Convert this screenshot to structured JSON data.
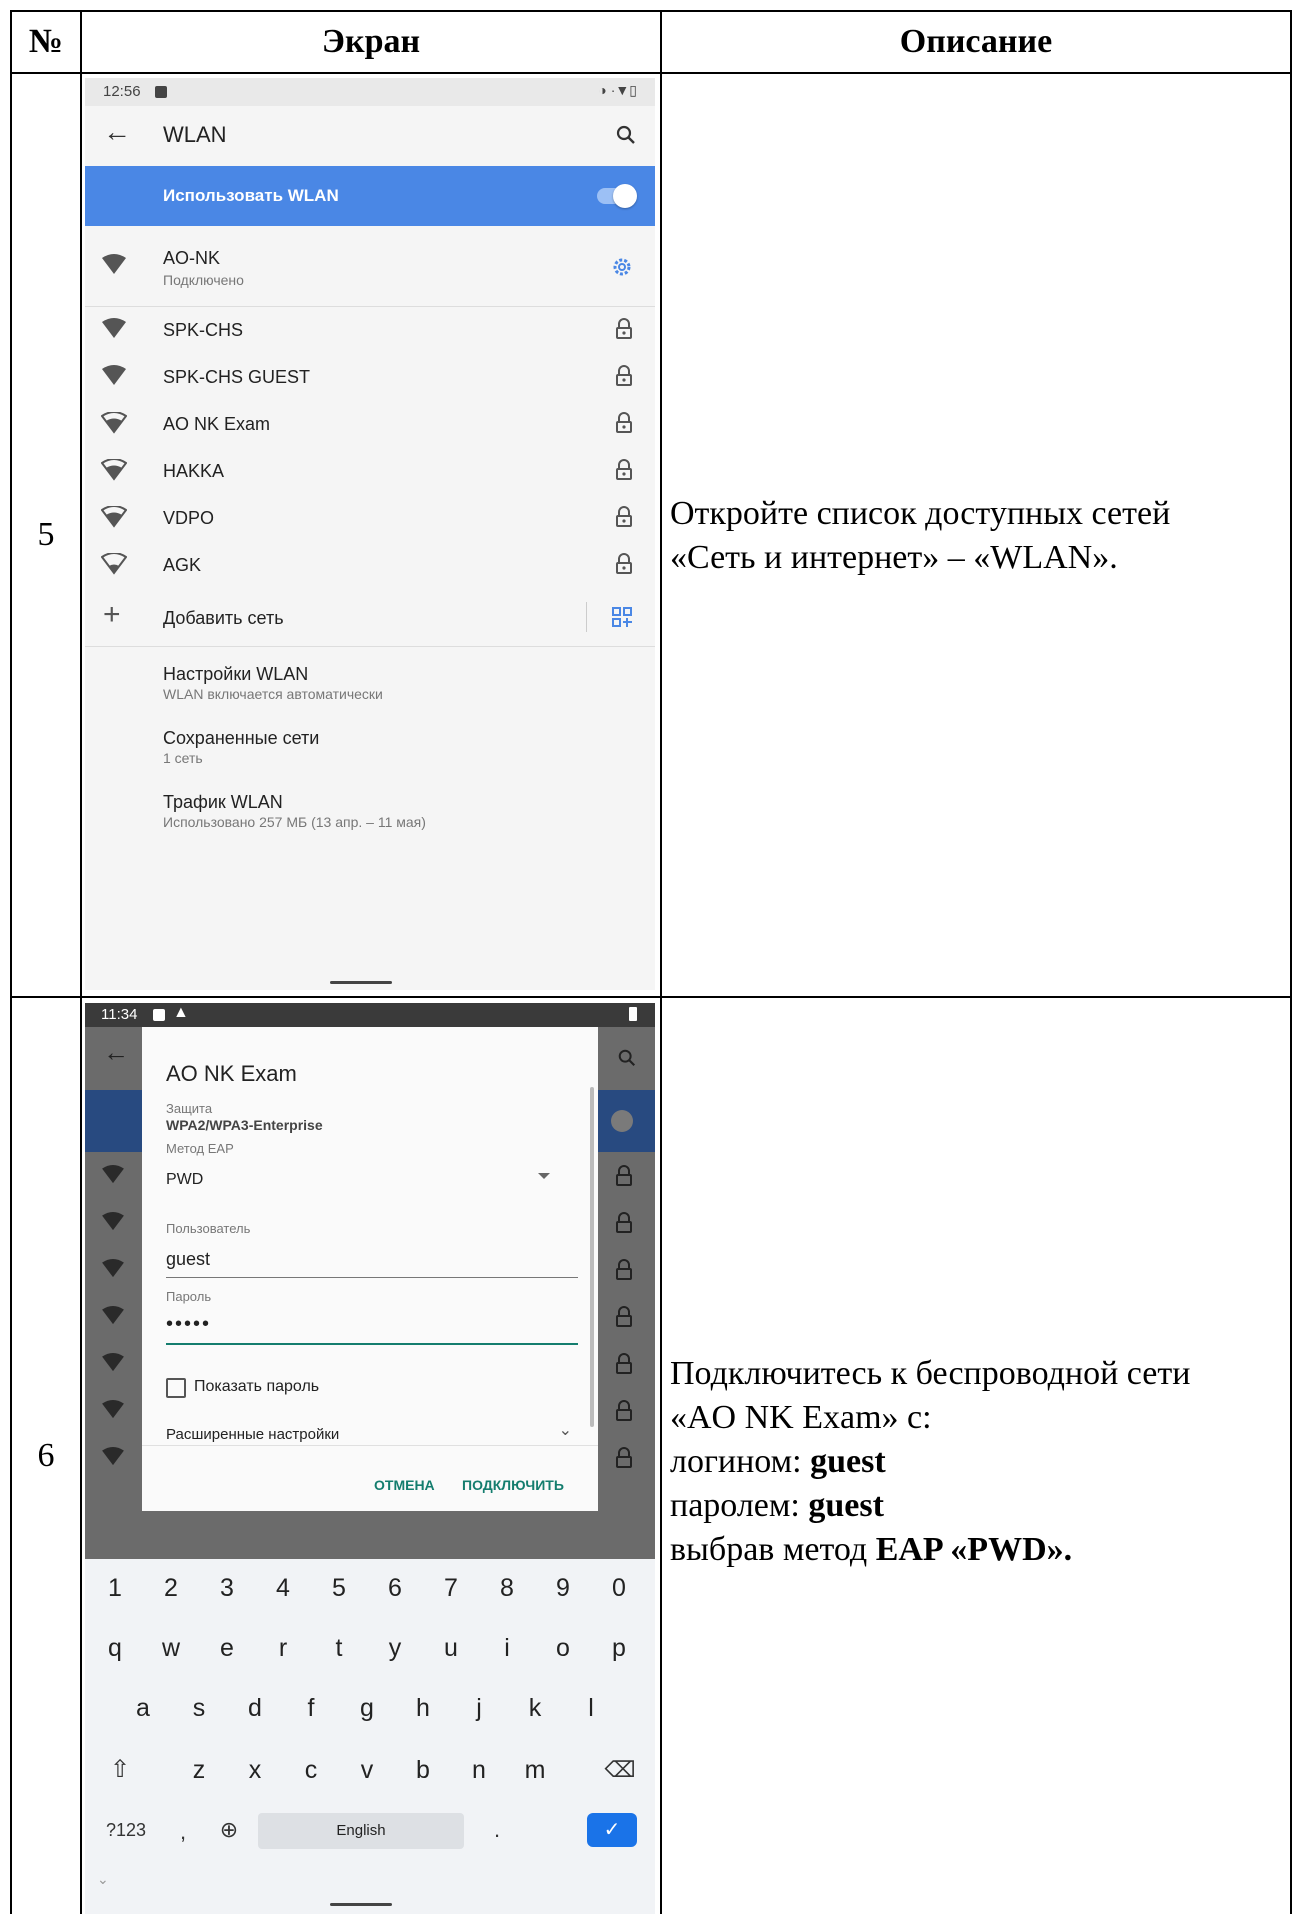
{
  "table": {
    "headers": {
      "num": "№",
      "screen": "Экран",
      "desc": "Описание"
    }
  },
  "row5": {
    "num": "5",
    "status_time": "12:56",
    "app_title": "WLAN",
    "toggle_label": "Использовать WLAN",
    "connected": {
      "name": "AO-NK",
      "status": "Подключено"
    },
    "networks": [
      "SPK-CHS",
      "SPK-CHS GUEST",
      "AO NK Exam",
      "HAKKA",
      "VDPO",
      "AGK"
    ],
    "add_network": "Добавить сеть",
    "settings": [
      {
        "title": "Настройки WLAN",
        "sub": "WLAN включается автоматически"
      },
      {
        "title": "Сохраненные сети",
        "sub": "1 сеть"
      },
      {
        "title": "Трафик WLAN",
        "sub": "Использовано 257 МБ (13 апр. – 11 мая)"
      }
    ],
    "desc_line1": "Откройте список доступных сетей",
    "desc_line2": "«Сеть и интернет» – «WLAN»."
  },
  "row6": {
    "num": "6",
    "status_time": "11:34",
    "dialog": {
      "title": "AO NK Exam",
      "security_label": "Защита",
      "security_value": "WPA2/WPA3-Enterprise",
      "eap_label": "Метод EAP",
      "eap_value": "PWD",
      "user_label": "Пользователь",
      "user_value": "guest",
      "password_label": "Пароль",
      "password_value": "•••••",
      "show_password": "Показать пароль",
      "advanced": "Расширенные настройки",
      "cancel": "ОТМЕНА",
      "connect": "ПОДКЛЮЧИТЬ"
    },
    "keyboard": {
      "row_numbers": [
        "1",
        "2",
        "3",
        "4",
        "5",
        "6",
        "7",
        "8",
        "9",
        "0"
      ],
      "row1": [
        "q",
        "w",
        "e",
        "r",
        "t",
        "y",
        "u",
        "i",
        "o",
        "p"
      ],
      "row2": [
        "a",
        "s",
        "d",
        "f",
        "g",
        "h",
        "j",
        "k",
        "l"
      ],
      "row3": [
        "z",
        "x",
        "c",
        "v",
        "b",
        "n",
        "m"
      ],
      "sym_key": "?123",
      "comma": ",",
      "space": "English",
      "period": "."
    },
    "desc_line1": "Подключитесь к беспроводной сети",
    "desc_line2": "«AO NK Exam» с:",
    "desc_login_prefix": "логином: ",
    "desc_login": "guest",
    "desc_pass_prefix": "паролем: ",
    "desc_pass": "guest",
    "desc_method_prefix": "выбрав метод ",
    "desc_method": "EAP «PWD»."
  },
  "colors": {
    "accent": "#4a87e5",
    "teal": "#147d6e",
    "border": "#000000"
  }
}
